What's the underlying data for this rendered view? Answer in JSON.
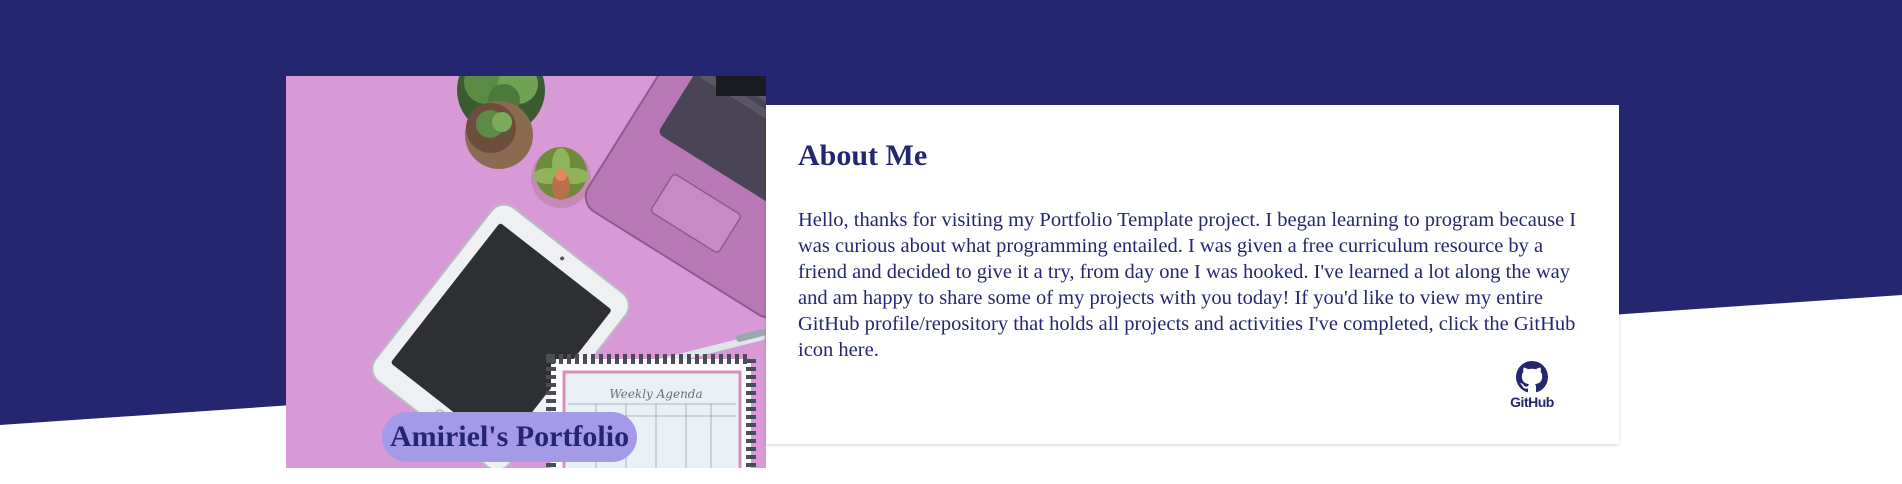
{
  "colors": {
    "navy": "#242770",
    "white": "#ffffff",
    "pink": "#d698d6",
    "pill": "#a59ae8"
  },
  "brand": {
    "name": "Amiriel's Portfolio"
  },
  "about": {
    "heading": "About Me",
    "body": "Hello, thanks for visiting my Portfolio Template project. I began learning to program because I was curious about what programming entailed. I was given a free curriculum resource by a friend and decided to give it a try, from day one I was hooked. I've learned a lot along the way and am happy to share some of my projects with you today! If you'd like to view my entire GitHub profile/repository that holds all projects and activities I've completed, click the GitHub icon here.",
    "github": {
      "icon": "github-icon",
      "label": "GitHub"
    }
  },
  "photo": {
    "subject": "desk-flatlay",
    "planner_heading": "Weekly Agenda"
  }
}
